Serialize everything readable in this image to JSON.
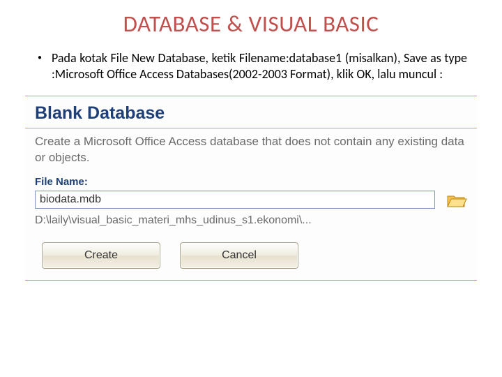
{
  "title": "DATABASE & VISUAL BASIC",
  "bullet": "Pada kotak File New Database, ketik Filename:database1 (misalkan), Save as type :Microsoft Office Access Databases(2002-2003 Format), klik OK, lalu muncul :",
  "panel": {
    "heading": "Blank Database",
    "description": "Create a Microsoft Office Access database that does not contain any existing data or objects.",
    "file_label": "File Name:",
    "file_value": "biodata.mdb",
    "path": "D:\\laily\\visual_basic_materi_mhs_udinus_s1.ekonomi\\...",
    "create_label": "Create",
    "cancel_label": "Cancel"
  }
}
